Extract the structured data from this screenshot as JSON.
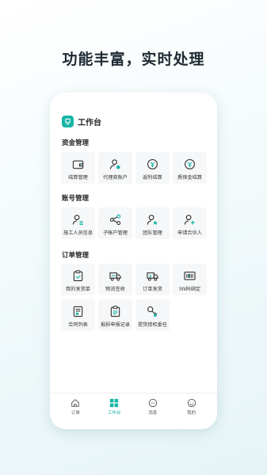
{
  "headline": "功能丰富，实时处理",
  "app": {
    "title": "工作台"
  },
  "sections": [
    {
      "title": "资金管理",
      "items": [
        {
          "label": "结算管理",
          "icon": "wallet-icon"
        },
        {
          "label": "代理商账户",
          "icon": "user-star-icon"
        },
        {
          "label": "返利结算",
          "icon": "rebate-coin-icon"
        },
        {
          "label": "质保金结算",
          "icon": "deposit-coin-icon"
        }
      ]
    },
    {
      "title": "账号管理",
      "items": [
        {
          "label": "施工人员信息",
          "icon": "user-list-icon"
        },
        {
          "label": "子帐户管理",
          "icon": "share-nodes-icon"
        },
        {
          "label": "团队管理",
          "icon": "team-user-icon"
        },
        {
          "label": "申请合伙人",
          "icon": "user-add-icon"
        }
      ]
    },
    {
      "title": "订单管理",
      "items": [
        {
          "label": "我的发货单",
          "icon": "clipboard-check-icon"
        },
        {
          "label": "物流签收",
          "icon": "truck-icon"
        },
        {
          "label": "订单发货",
          "icon": "delivery-truck-icon"
        },
        {
          "label": "SN码绑定",
          "icon": "barcode-icon"
        },
        {
          "label": "合同列表",
          "icon": "contract-icon"
        },
        {
          "label": "报损申报记录",
          "icon": "report-list-icon"
        },
        {
          "label": "提货授权委任",
          "icon": "key-icon"
        }
      ]
    }
  ],
  "tabs": [
    {
      "label": "订单",
      "icon": "home-icon",
      "active": false
    },
    {
      "label": "工作台",
      "icon": "grid-icon",
      "active": true
    },
    {
      "label": "消息",
      "icon": "message-icon",
      "active": false
    },
    {
      "label": "我的",
      "icon": "profile-icon",
      "active": false
    }
  ],
  "colors": {
    "accent": "#17b6a7",
    "text": "#222222",
    "tile_bg": "#f6f7f8"
  }
}
